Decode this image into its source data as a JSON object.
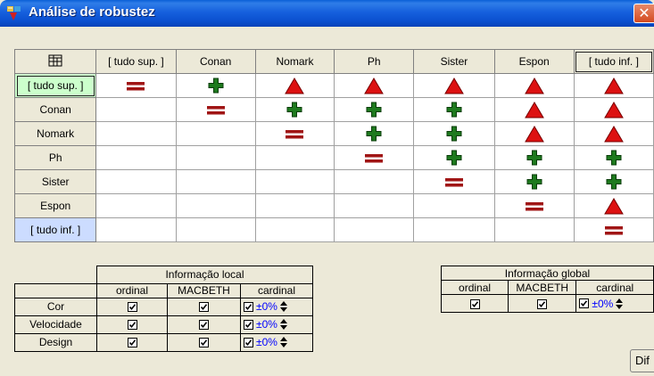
{
  "window": {
    "title": "Análise de robustez"
  },
  "matrix": {
    "corner_icon": "table-icon",
    "columns": [
      "[ tudo sup. ]",
      "Conan",
      "Nomark",
      "Ph",
      "Sister",
      "Espon",
      "[ tudo inf. ]"
    ],
    "rows": [
      {
        "label": "[ tudo sup. ]",
        "cells": [
          "equal",
          "plus",
          "triangle",
          "triangle",
          "triangle",
          "triangle",
          "triangle"
        ]
      },
      {
        "label": "Conan",
        "cells": [
          "",
          "equal",
          "plus",
          "plus",
          "plus",
          "triangle",
          "triangle"
        ]
      },
      {
        "label": "Nomark",
        "cells": [
          "",
          "",
          "equal",
          "plus",
          "plus",
          "triangle",
          "triangle"
        ]
      },
      {
        "label": "Ph",
        "cells": [
          "",
          "",
          "",
          "equal",
          "plus",
          "plus",
          "plus"
        ]
      },
      {
        "label": "Sister",
        "cells": [
          "",
          "",
          "",
          "",
          "equal",
          "plus",
          "plus"
        ]
      },
      {
        "label": "Espon",
        "cells": [
          "",
          "",
          "",
          "",
          "",
          "equal",
          "triangle"
        ]
      },
      {
        "label": "[ tudo inf. ]",
        "cells": [
          "",
          "",
          "",
          "",
          "",
          "",
          "equal"
        ]
      }
    ],
    "colors": {
      "plus": "#1e7a1e",
      "triangle": "#dd1111",
      "equal": "#a01515",
      "sup_bg": "#ccffcc",
      "inf_bg": "#ccdcff"
    }
  },
  "local_info": {
    "title": "Informação local",
    "headers": [
      "ordinal",
      "MACBETH",
      "cardinal"
    ],
    "rows": [
      {
        "label": "Cor",
        "ordinal": true,
        "macbeth": true,
        "cardinal": true,
        "pct": "±0%"
      },
      {
        "label": "Velocidade",
        "ordinal": true,
        "macbeth": true,
        "cardinal": true,
        "pct": "±0%"
      },
      {
        "label": "Design",
        "ordinal": true,
        "macbeth": true,
        "cardinal": true,
        "pct": "±0%"
      }
    ]
  },
  "global_info": {
    "title": "Informação global",
    "headers": [
      "ordinal",
      "MACBETH",
      "cardinal"
    ],
    "row": {
      "ordinal": true,
      "macbeth": true,
      "cardinal": true,
      "pct": "±0%"
    }
  },
  "buttons": {
    "dif_label": "Dif"
  }
}
